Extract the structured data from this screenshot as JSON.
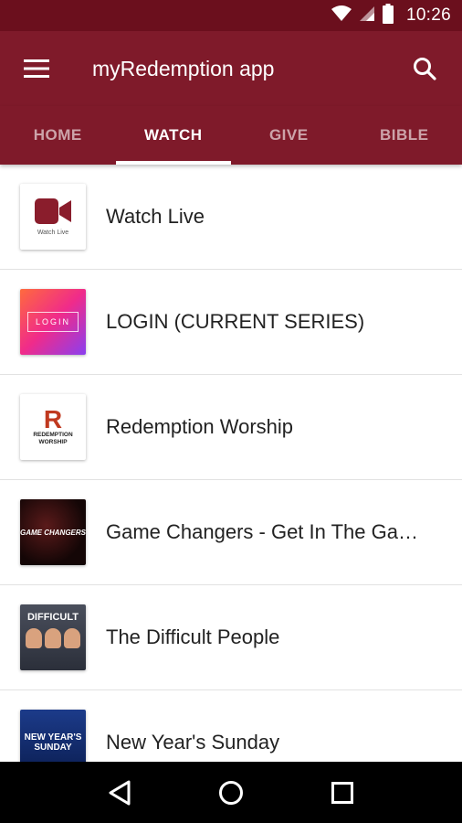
{
  "status_bar": {
    "time": "10:26",
    "icons": [
      "wifi-icon",
      "signal-icon",
      "battery-icon"
    ]
  },
  "app_bar": {
    "title": "myRedemption app",
    "menu_icon": "hamburger-menu-icon",
    "search_icon": "search-icon",
    "color": "#7f1a2a"
  },
  "tabs": [
    {
      "label": "HOME",
      "active": false
    },
    {
      "label": "WATCH",
      "active": true
    },
    {
      "label": "GIVE",
      "active": false
    },
    {
      "label": "BIBLE",
      "active": false
    }
  ],
  "list": {
    "items": [
      {
        "label": "Watch Live",
        "thumb_caption": "Watch Live"
      },
      {
        "label": "LOGIN (CURRENT SERIES)",
        "thumb_caption": "LOGIN"
      },
      {
        "label": "Redemption Worship",
        "thumb_caption": "R",
        "thumb_subcaption": "REDEMPTION WORSHIP"
      },
      {
        "label": "Game Changers - Get In The Ga…",
        "thumb_caption": "GAME CHANGERS"
      },
      {
        "label": "The Difficult People",
        "thumb_caption": "DIFFICULT"
      },
      {
        "label": "New Year's Sunday",
        "thumb_caption": "NEW YEAR'S SUNDAY"
      }
    ]
  },
  "nav_bar": {
    "icons": [
      "back-icon",
      "home-icon",
      "recents-icon"
    ]
  }
}
